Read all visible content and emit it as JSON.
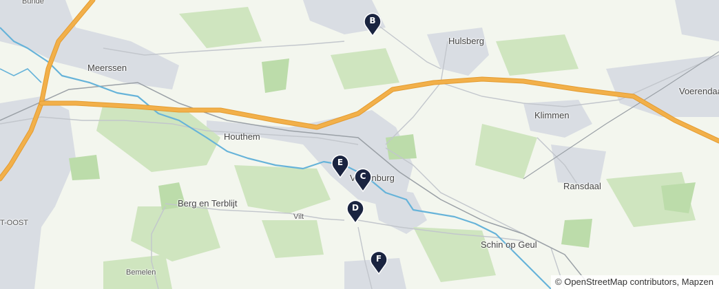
{
  "map": {
    "attribution": "© OpenStreetMap contributors, Mapzen",
    "colors": {
      "land": "#f3f6ee",
      "urban": "#d9dde3",
      "green": "#cfe5bf",
      "motorway": "#f0a93b",
      "river": "#66b3d9",
      "marker": "#1a2440"
    }
  },
  "places": {
    "bunde": "Bunde",
    "meerssen": "Meerssen",
    "hulsberg": "Hulsberg",
    "voerendaal": "Voerendaal",
    "klimmen": "Klimmen",
    "houthem": "Houthem",
    "valkenburg": "Valkenburg",
    "ransdaal": "Ransdaal",
    "berg_en_terblijt": "Berg en Terblijt",
    "vilt": "Vilt",
    "oost": "T-OOST",
    "schin_op_geul": "Schin op Geul",
    "bemelen": "Bemelen"
  },
  "markers": [
    {
      "id": "b",
      "label": "B"
    },
    {
      "id": "e",
      "label": "E"
    },
    {
      "id": "c",
      "label": "C"
    },
    {
      "id": "d",
      "label": "D"
    },
    {
      "id": "f",
      "label": "F"
    }
  ]
}
